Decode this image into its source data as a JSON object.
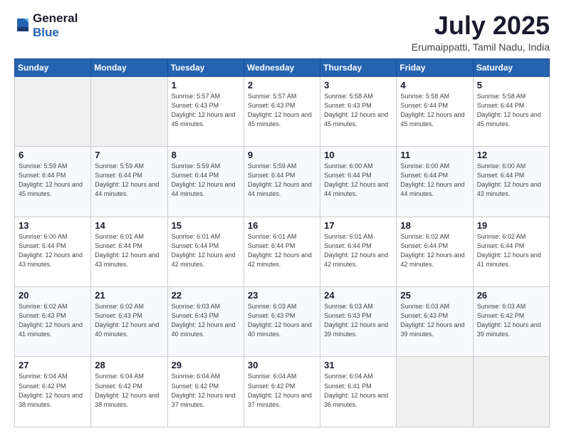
{
  "logo": {
    "general": "General",
    "blue": "Blue"
  },
  "header": {
    "month": "July 2025",
    "location": "Erumaippatti, Tamil Nadu, India"
  },
  "weekdays": [
    "Sunday",
    "Monday",
    "Tuesday",
    "Wednesday",
    "Thursday",
    "Friday",
    "Saturday"
  ],
  "weeks": [
    [
      {
        "day": "",
        "info": ""
      },
      {
        "day": "",
        "info": ""
      },
      {
        "day": "1",
        "info": "Sunrise: 5:57 AM\nSunset: 6:43 PM\nDaylight: 12 hours and 45 minutes."
      },
      {
        "day": "2",
        "info": "Sunrise: 5:57 AM\nSunset: 6:43 PM\nDaylight: 12 hours and 45 minutes."
      },
      {
        "day": "3",
        "info": "Sunrise: 5:58 AM\nSunset: 6:43 PM\nDaylight: 12 hours and 45 minutes."
      },
      {
        "day": "4",
        "info": "Sunrise: 5:58 AM\nSunset: 6:44 PM\nDaylight: 12 hours and 45 minutes."
      },
      {
        "day": "5",
        "info": "Sunrise: 5:58 AM\nSunset: 6:44 PM\nDaylight: 12 hours and 45 minutes."
      }
    ],
    [
      {
        "day": "6",
        "info": "Sunrise: 5:59 AM\nSunset: 6:44 PM\nDaylight: 12 hours and 45 minutes."
      },
      {
        "day": "7",
        "info": "Sunrise: 5:59 AM\nSunset: 6:44 PM\nDaylight: 12 hours and 44 minutes."
      },
      {
        "day": "8",
        "info": "Sunrise: 5:59 AM\nSunset: 6:44 PM\nDaylight: 12 hours and 44 minutes."
      },
      {
        "day": "9",
        "info": "Sunrise: 5:59 AM\nSunset: 6:44 PM\nDaylight: 12 hours and 44 minutes."
      },
      {
        "day": "10",
        "info": "Sunrise: 6:00 AM\nSunset: 6:44 PM\nDaylight: 12 hours and 44 minutes."
      },
      {
        "day": "11",
        "info": "Sunrise: 6:00 AM\nSunset: 6:44 PM\nDaylight: 12 hours and 44 minutes."
      },
      {
        "day": "12",
        "info": "Sunrise: 6:00 AM\nSunset: 6:44 PM\nDaylight: 12 hours and 43 minutes."
      }
    ],
    [
      {
        "day": "13",
        "info": "Sunrise: 6:00 AM\nSunset: 6:44 PM\nDaylight: 12 hours and 43 minutes."
      },
      {
        "day": "14",
        "info": "Sunrise: 6:01 AM\nSunset: 6:44 PM\nDaylight: 12 hours and 43 minutes."
      },
      {
        "day": "15",
        "info": "Sunrise: 6:01 AM\nSunset: 6:44 PM\nDaylight: 12 hours and 42 minutes."
      },
      {
        "day": "16",
        "info": "Sunrise: 6:01 AM\nSunset: 6:44 PM\nDaylight: 12 hours and 42 minutes."
      },
      {
        "day": "17",
        "info": "Sunrise: 6:01 AM\nSunset: 6:44 PM\nDaylight: 12 hours and 42 minutes."
      },
      {
        "day": "18",
        "info": "Sunrise: 6:02 AM\nSunset: 6:44 PM\nDaylight: 12 hours and 42 minutes."
      },
      {
        "day": "19",
        "info": "Sunrise: 6:02 AM\nSunset: 6:44 PM\nDaylight: 12 hours and 41 minutes."
      }
    ],
    [
      {
        "day": "20",
        "info": "Sunrise: 6:02 AM\nSunset: 6:43 PM\nDaylight: 12 hours and 41 minutes."
      },
      {
        "day": "21",
        "info": "Sunrise: 6:02 AM\nSunset: 6:43 PM\nDaylight: 12 hours and 40 minutes."
      },
      {
        "day": "22",
        "info": "Sunrise: 6:03 AM\nSunset: 6:43 PM\nDaylight: 12 hours and 40 minutes."
      },
      {
        "day": "23",
        "info": "Sunrise: 6:03 AM\nSunset: 6:43 PM\nDaylight: 12 hours and 40 minutes."
      },
      {
        "day": "24",
        "info": "Sunrise: 6:03 AM\nSunset: 6:43 PM\nDaylight: 12 hours and 39 minutes."
      },
      {
        "day": "25",
        "info": "Sunrise: 6:03 AM\nSunset: 6:43 PM\nDaylight: 12 hours and 39 minutes."
      },
      {
        "day": "26",
        "info": "Sunrise: 6:03 AM\nSunset: 6:42 PM\nDaylight: 12 hours and 39 minutes."
      }
    ],
    [
      {
        "day": "27",
        "info": "Sunrise: 6:04 AM\nSunset: 6:42 PM\nDaylight: 12 hours and 38 minutes."
      },
      {
        "day": "28",
        "info": "Sunrise: 6:04 AM\nSunset: 6:42 PM\nDaylight: 12 hours and 38 minutes."
      },
      {
        "day": "29",
        "info": "Sunrise: 6:04 AM\nSunset: 6:42 PM\nDaylight: 12 hours and 37 minutes."
      },
      {
        "day": "30",
        "info": "Sunrise: 6:04 AM\nSunset: 6:42 PM\nDaylight: 12 hours and 37 minutes."
      },
      {
        "day": "31",
        "info": "Sunrise: 6:04 AM\nSunset: 6:41 PM\nDaylight: 12 hours and 36 minutes."
      },
      {
        "day": "",
        "info": ""
      },
      {
        "day": "",
        "info": ""
      }
    ]
  ]
}
